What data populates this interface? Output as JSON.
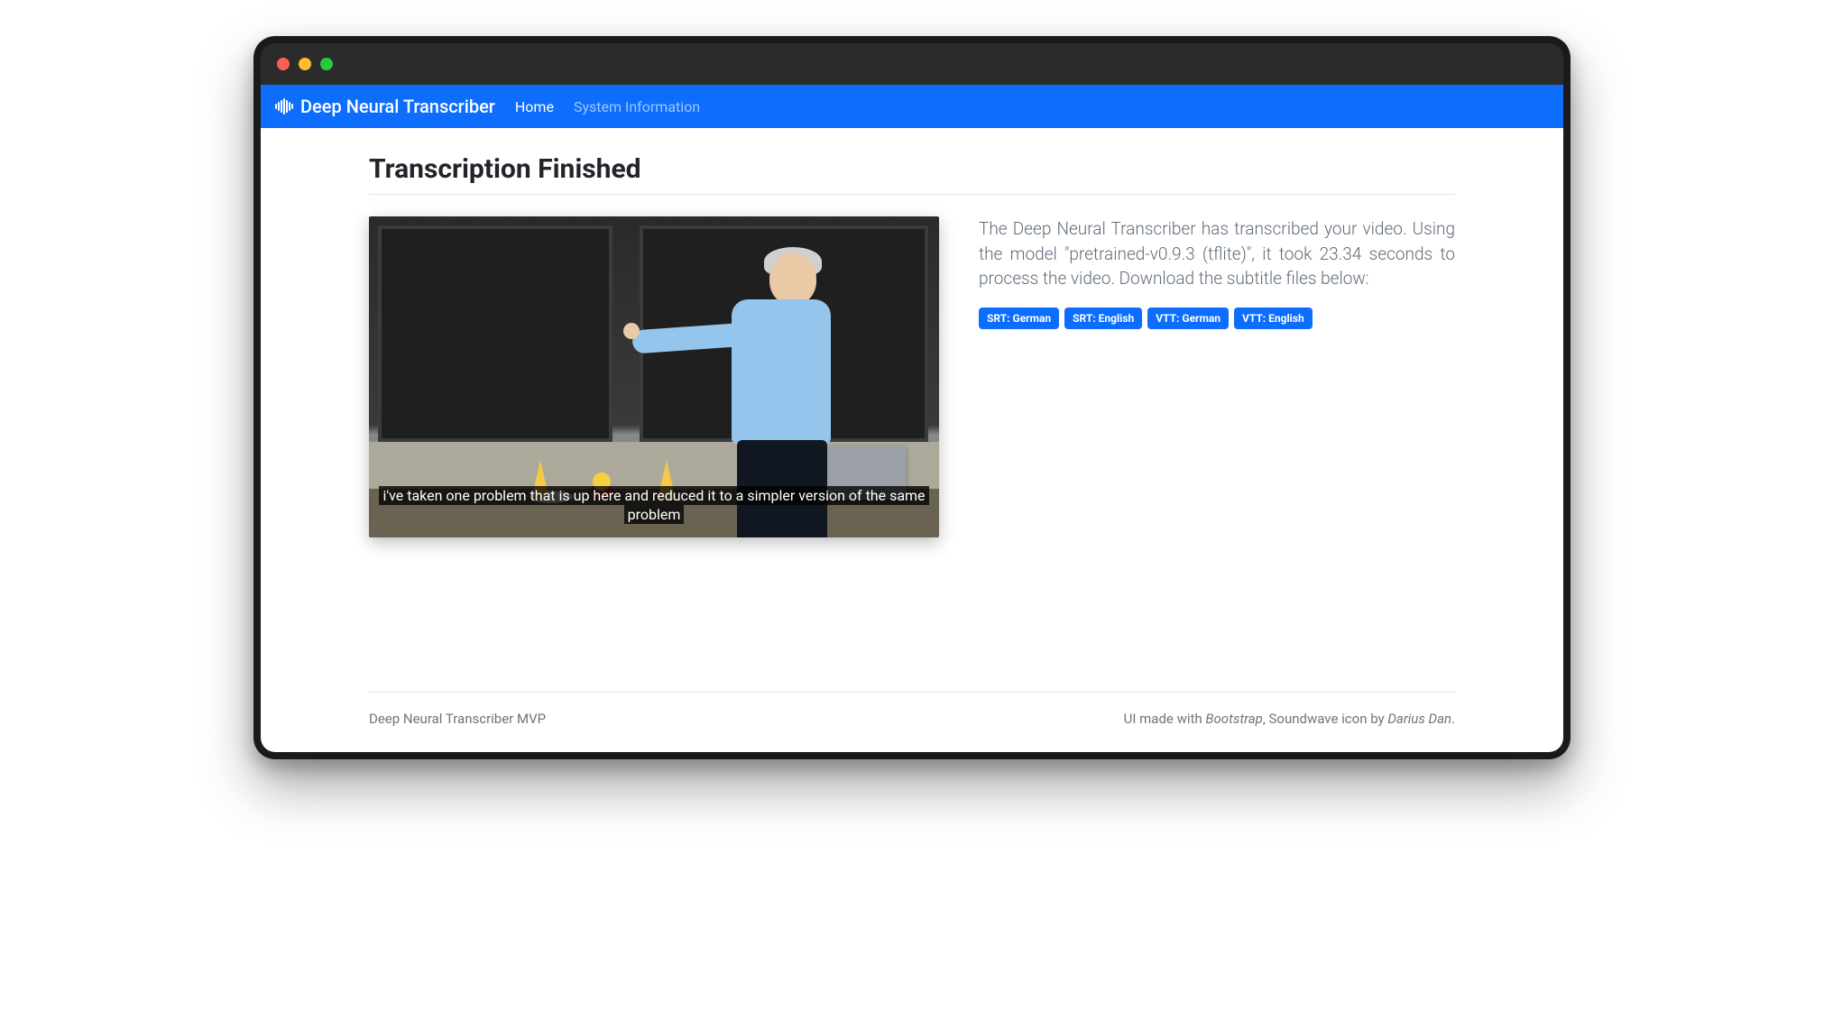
{
  "brand": "Deep Neural Transcriber",
  "nav": {
    "home": "Home",
    "sysinfo": "System Information"
  },
  "page_title": "Transcription Finished",
  "caption_text": "i've taken one problem that is up here and reduced it to a simpler version of the same problem",
  "description": "The Deep Neural Transcriber has transcribed your video. Using the model \"pretrained-v0.9.3 (tflite)\", it took 23.34 seconds to process the video. Download the subtitle files below:",
  "downloads": [
    "SRT: German",
    "SRT: English",
    "VTT: German",
    "VTT: English"
  ],
  "footer_left": "Deep Neural Transcriber MVP",
  "footer_right_prefix": "UI made with ",
  "footer_right_em1": "Bootstrap",
  "footer_right_mid": ", Soundwave icon by ",
  "footer_right_em2": "Darius Dan",
  "footer_right_suffix": "."
}
